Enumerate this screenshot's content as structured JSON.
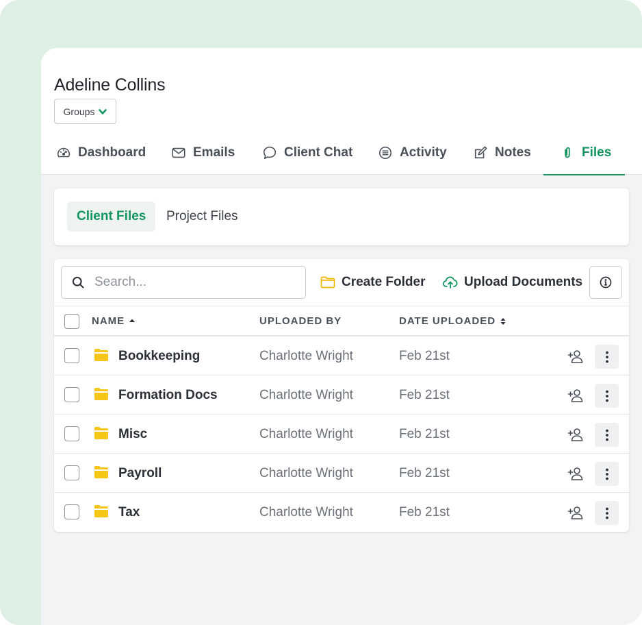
{
  "client": {
    "name": "Adeline Collins",
    "groups_label": "Groups"
  },
  "nav": {
    "tabs": [
      {
        "label": "Dashboard",
        "icon": "gauge-icon"
      },
      {
        "label": "Emails",
        "icon": "envelope-icon"
      },
      {
        "label": "Client Chat",
        "icon": "chat-bubble-icon"
      },
      {
        "label": "Activity",
        "icon": "list-circle-icon"
      },
      {
        "label": "Notes",
        "icon": "edit-note-icon"
      },
      {
        "label": "Files",
        "icon": "paperclip-icon",
        "active": true
      }
    ]
  },
  "subtabs": {
    "client_files": "Client Files",
    "project_files": "Project Files",
    "active": "Client Files"
  },
  "toolbar": {
    "search_placeholder": "Search...",
    "create_folder": "Create Folder",
    "upload_documents": "Upload Documents"
  },
  "table": {
    "columns": {
      "name": "NAME",
      "uploaded_by": "UPLOADED BY",
      "date_uploaded": "DATE UPLOADED"
    },
    "rows": [
      {
        "name": "Bookkeeping",
        "uploaded_by": "Charlotte Wright",
        "date": "Feb 21st"
      },
      {
        "name": "Formation Docs",
        "uploaded_by": "Charlotte Wright",
        "date": "Feb 21st"
      },
      {
        "name": "Misc",
        "uploaded_by": "Charlotte Wright",
        "date": "Feb 21st"
      },
      {
        "name": "Payroll",
        "uploaded_by": "Charlotte Wright",
        "date": "Feb 21st"
      },
      {
        "name": "Tax",
        "uploaded_by": "Charlotte Wright",
        "date": "Feb 21st"
      }
    ]
  },
  "colors": {
    "accent": "#12955f",
    "folder": "#f5c518",
    "background_outer": "#deefe3"
  }
}
